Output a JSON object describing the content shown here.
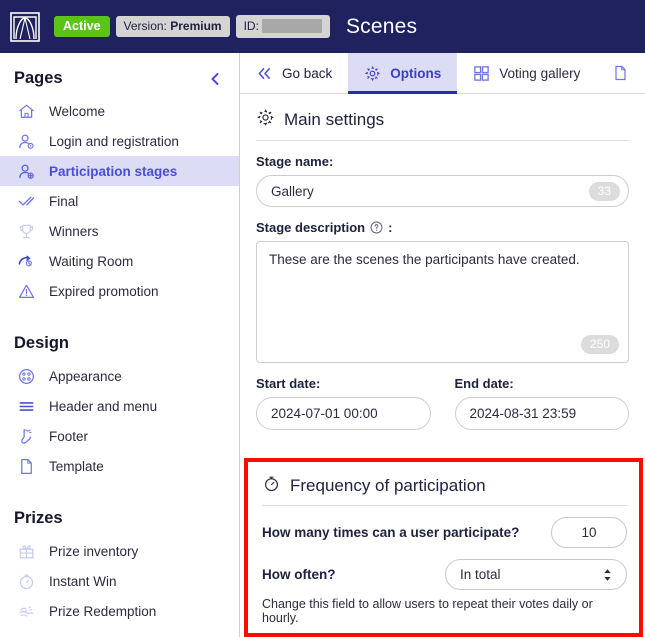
{
  "topbar": {
    "logo_icon": "brand-arch-logo-icon",
    "status_badge": "Active",
    "version_prefix": "Version:",
    "version_value": "Premium",
    "id_label": "ID:",
    "id_value_redacted": "",
    "title": "Scenes"
  },
  "sidebar": {
    "sections": [
      {
        "title": "Pages",
        "collapse_icon": "chevron-left-icon",
        "items": [
          {
            "label": "Welcome",
            "icon": "home-icon",
            "active": false,
            "dim": false
          },
          {
            "label": "Login and registration",
            "icon": "user-settings-icon",
            "active": false,
            "dim": false
          },
          {
            "label": "Participation stages",
            "icon": "user-add-icon",
            "active": true,
            "dim": false
          },
          {
            "label": "Final",
            "icon": "check-double-icon",
            "active": false,
            "dim": false
          },
          {
            "label": "Winners",
            "icon": "trophy-icon",
            "active": false,
            "dim": true
          },
          {
            "label": "Waiting Room",
            "icon": "waiting-room-icon",
            "active": false,
            "dim": false
          },
          {
            "label": "Expired promotion",
            "icon": "warning-triangle-icon",
            "active": false,
            "dim": false
          }
        ]
      },
      {
        "title": "Design",
        "items": [
          {
            "label": "Appearance",
            "icon": "palette-icon",
            "active": false,
            "dim": false
          },
          {
            "label": "Header and menu",
            "icon": "menu-lines-icon",
            "active": false,
            "dim": false
          },
          {
            "label": "Footer",
            "icon": "footer-sock-icon",
            "active": false,
            "dim": false
          },
          {
            "label": "Template",
            "icon": "page-icon",
            "active": false,
            "dim": false
          }
        ]
      },
      {
        "title": "Prizes",
        "items": [
          {
            "label": "Prize inventory",
            "icon": "gift-icon",
            "active": false,
            "dim": true
          },
          {
            "label": "Instant Win",
            "icon": "stopwatch-icon",
            "active": false,
            "dim": true
          },
          {
            "label": "Prize Redemption",
            "icon": "hand-gift-icon",
            "active": false,
            "dim": true
          }
        ]
      }
    ]
  },
  "tabs": [
    {
      "label": "Go back",
      "icon": "double-chevron-left-icon",
      "active": false
    },
    {
      "label": "Options",
      "icon": "gear-icon",
      "active": true
    },
    {
      "label": "Voting gallery",
      "icon": "grid-four-icon",
      "active": false
    },
    {
      "label": "",
      "icon": "page-icon",
      "active": false
    }
  ],
  "main_settings": {
    "heading": "Main settings",
    "heading_icon": "gear-icon",
    "stage_name": {
      "label": "Stage name:",
      "value": "Gallery",
      "counter": "33"
    },
    "stage_description": {
      "label": "Stage description",
      "help_icon": "question-circle-icon",
      "label_suffix": ":",
      "value": "These are the scenes the participants have created.",
      "counter": "250"
    },
    "start_date": {
      "label": "Start date:",
      "value": "2024-07-01 00:00"
    },
    "end_date": {
      "label": "End date:",
      "value": "2024-08-31 23:59"
    }
  },
  "frequency": {
    "heading": "Frequency of participation",
    "heading_icon": "stopwatch-icon",
    "times_question": "How many times can a user participate?",
    "times_value": "10",
    "often_question": "How often?",
    "often_value": "In total",
    "hint": "Change this field to allow users to repeat their votes daily or hourly.",
    "highlight_color": "#fb0b00"
  },
  "annotation": {
    "arrow_color": "#fb0b00",
    "arrow_points_to": "Options tab"
  },
  "colors": {
    "topbar_bg": "#1f225e",
    "active_green": "#5cc319",
    "accent_violet": "#4a4ed6",
    "tab_active_bg": "#dcdcf5",
    "tab_underline": "#2a2da8"
  }
}
